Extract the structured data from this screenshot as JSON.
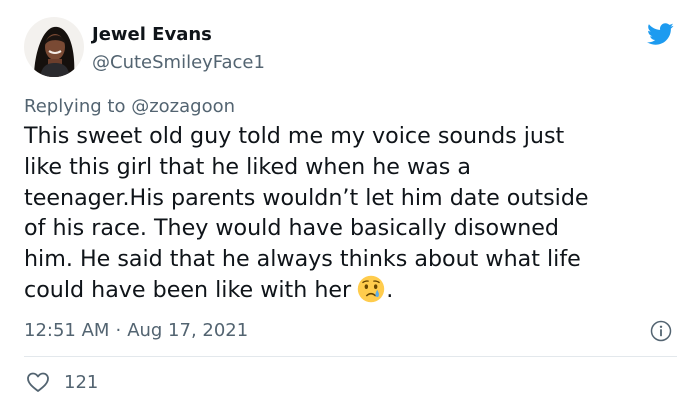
{
  "author": {
    "name": "Jewel Evans",
    "handle": "@CuteSmileyFace1"
  },
  "reply": {
    "prefix": "Replying to ",
    "mention": "@zozagoon"
  },
  "tweet": {
    "lines": [
      "This sweet old guy told me my voice sounds just",
      "like this girl that he liked when he was a",
      "teenager.His parents wouldn’t let him date outside",
      "of his race. They would have basically disowned",
      "him. He said that he always thinks about what life",
      "could have been like with her"
    ],
    "trailing_punct": ".",
    "emoji": "crying-face"
  },
  "meta": {
    "time": "12:51 AM",
    "separator": "·",
    "date": "Aug 17, 2021"
  },
  "engagement": {
    "likes": "121"
  },
  "colors": {
    "twitter_blue": "#1d9bf0",
    "text_primary": "#0f1419",
    "text_secondary": "#536471",
    "divider": "#e3e8ec"
  },
  "icons": {
    "brand": "twitter-bird-icon",
    "info": "info-icon",
    "like": "heart-outline-icon",
    "emoji": "crying-face-emoji-icon"
  }
}
